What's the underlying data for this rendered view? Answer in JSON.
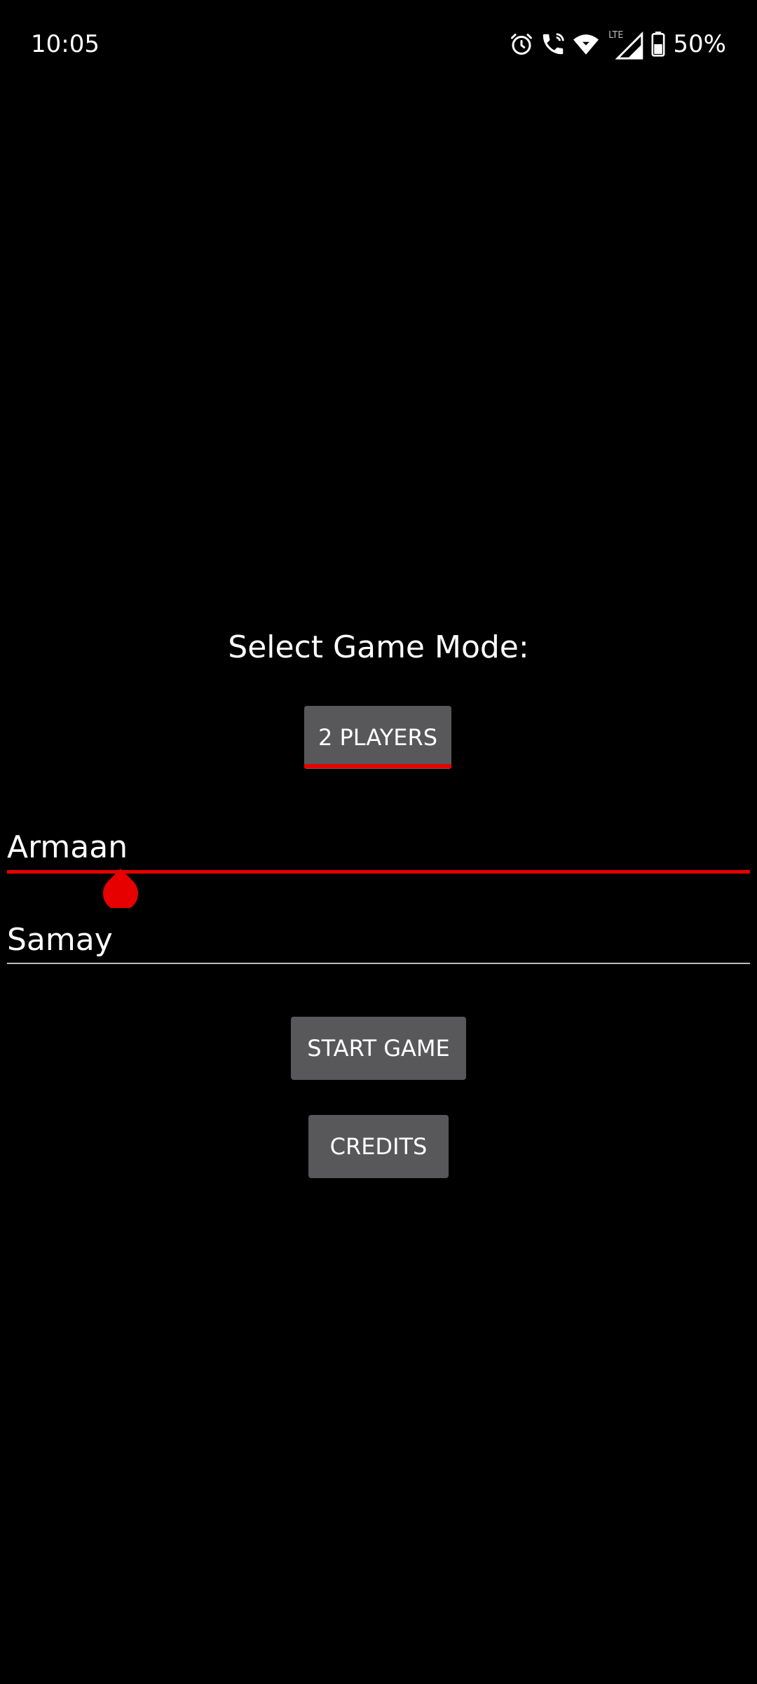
{
  "status_bar": {
    "time": "10:05",
    "battery": "50%",
    "network": "LTE",
    "icons": [
      "alarm-icon",
      "wifi-calling-icon",
      "wifi-icon",
      "signal-icon",
      "battery-icon"
    ]
  },
  "screen": {
    "title": "Select Game Mode:",
    "mode_button": "2 PLAYERS",
    "player1_name": "Armaan",
    "player2_name": "Samay",
    "start_button": "START GAME",
    "credits_button": "CREDITS"
  },
  "colors": {
    "background": "#000000",
    "button": "#58585a",
    "accent": "#e60000",
    "text": "#ffffff"
  }
}
